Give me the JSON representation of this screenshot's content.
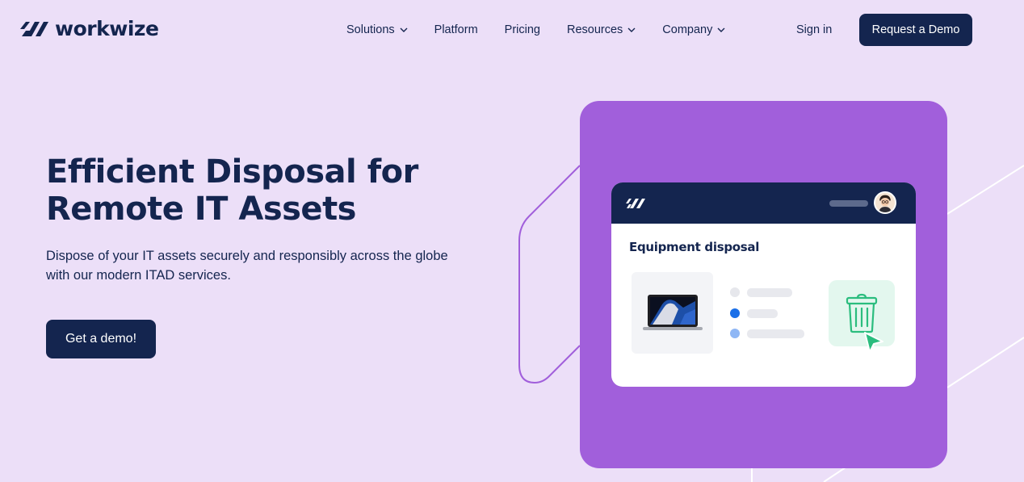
{
  "brand": {
    "name": "workwize"
  },
  "nav": {
    "items": [
      {
        "label": "Solutions",
        "has_dropdown": true
      },
      {
        "label": "Platform",
        "has_dropdown": false
      },
      {
        "label": "Pricing",
        "has_dropdown": false
      },
      {
        "label": "Resources",
        "has_dropdown": true
      },
      {
        "label": "Company",
        "has_dropdown": true
      }
    ],
    "sign_in": "Sign in",
    "request_demo": "Request a Demo"
  },
  "hero": {
    "title_line1": "Efficient Disposal for",
    "title_line2": "Remote IT Assets",
    "subtitle_line1": "Dispose of your IT assets securely and responsibly across the globe",
    "subtitle_line2": "with our modern ITAD services.",
    "cta": "Get a demo!"
  },
  "illustration": {
    "window_title": "Equipment disposal",
    "icons": [
      "workwize-logo-icon",
      "avatar",
      "laptop-icon",
      "trash-icon",
      "cursor-icon"
    ]
  },
  "colors": {
    "background": "#ecdff8",
    "navy": "#14254f",
    "purple_card": "#a15fdb",
    "accent_blue": "#1a6fe8",
    "accent_green": "#2bbd7e"
  }
}
